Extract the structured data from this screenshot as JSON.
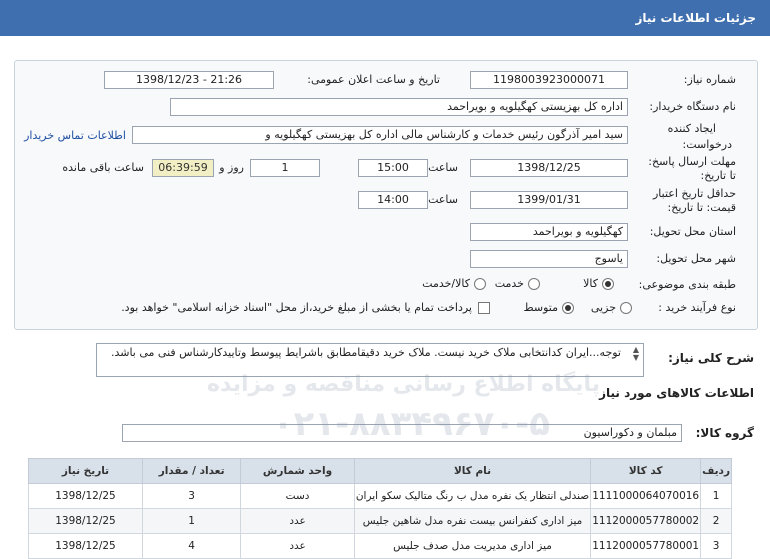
{
  "header": {
    "title": "جزئیات اطلاعات نیاز"
  },
  "form": {
    "need_number_label": "شماره نیاز:",
    "need_number": "1198003923000071",
    "announce_label": "تاریخ و ساعت اعلان عمومی:",
    "announce_value": "1398/12/23 - 21:26",
    "buyer_label": "نام دستگاه خریدار:",
    "buyer_value": "اداره کل بهزیستی کهگیلویه و بویراحمد",
    "creator_label_1": "ایجاد کننده",
    "creator_label_2": "درخواست:",
    "creator_value": "سید امیر آذرگون رئیس خدمات و کارشناس مالی اداره کل بهزیستی کهگیلویه و",
    "contact_link": "اطلاعات تماس خریدار",
    "reply_label_1": "مهلت ارسال پاسخ:",
    "reply_label_2": "تا تاریخ:",
    "reply_date": "1398/12/25",
    "time_label": "ساعت",
    "reply_time": "15:00",
    "days_value": "1",
    "days_label": "روز و",
    "remaining_time": "06:39:59",
    "remaining_label": "ساعت باقی مانده",
    "validity_label_1": "حداقل تاریخ اعتبار",
    "validity_label_2": "قیمت: تا تاریخ:",
    "validity_date": "1399/01/31",
    "validity_time": "14:00",
    "province_label": "استان محل تحویل:",
    "province_value": "کهگیلویه و بویراحمد",
    "city_label": "شهر محل تحویل:",
    "city_value": "یاسوج",
    "category_label": "طبقه بندی موضوعی:",
    "category_options": [
      "کالا",
      "خدمت",
      "کالا/خدمت"
    ],
    "purchase_label": "نوع فرآیند خرید :",
    "purchase_options": [
      "جزیی",
      "متوسط"
    ],
    "treasury_text": "پرداخت تمام یا بخشی از مبلغ خرید،از محل \"اسناد خزانه اسلامی\" خواهد بود."
  },
  "description": {
    "label": "شرح کلی نیاز:",
    "text": "توجه...ایران کدانتخابی ملاک خرید نیست. ملاک خرید دقیقامطابق باشرایط پیوسط وتاییدکارشناس فنی می باشد."
  },
  "goods": {
    "section_title": "اطلاعات کالاهای مورد نیاز",
    "group_label": "گروه کالا:",
    "group_value": "مبلمان و دکوراسیون",
    "columns": [
      "ردیف",
      "کد کالا",
      "نام کالا",
      "واحد شمارش",
      "تعداد / مقدار",
      "تاریخ نیاز"
    ],
    "rows": [
      [
        "1",
        "1111000064070016",
        "صندلی انتظار یک نفره مدل ب رنگ متالیک سکو ایران",
        "دست",
        "3",
        "1398/12/25"
      ],
      [
        "2",
        "1112000057780002",
        "میز اداری کنفرانس بیست نفره مدل شاهین جلیس",
        "عدد",
        "1",
        "1398/12/25"
      ],
      [
        "3",
        "1112000057780001",
        "میز اداری مدیریت مدل صدف جلیس",
        "عدد",
        "4",
        "1398/12/25"
      ]
    ]
  },
  "watermark": {
    "line1": "پایگاه اطلاع رسانی مناقصه و مزایده",
    "line2": "۰۲۱-۸۸۳۴۹۶۷۰-۵"
  }
}
